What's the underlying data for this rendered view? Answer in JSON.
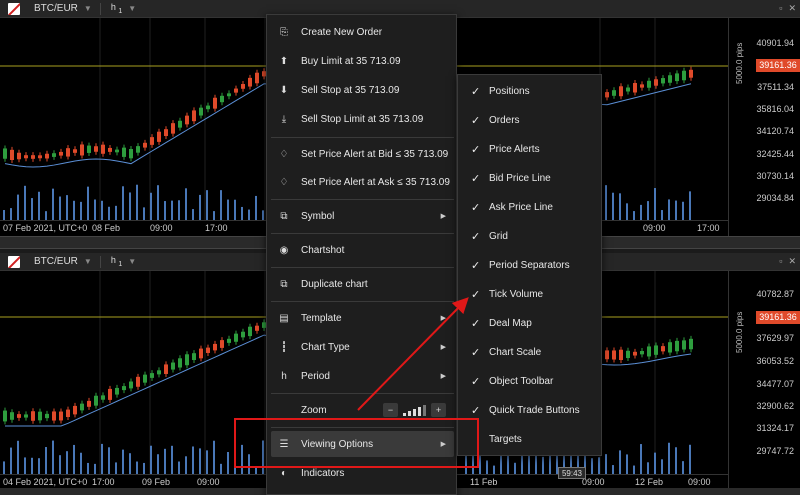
{
  "top_chart": {
    "symbol": "BTC/EUR",
    "period_label": "h",
    "period_sub": "1",
    "y_ticks": [
      "40901.94",
      "37511.34",
      "35816.04",
      "34120.74",
      "32425.44",
      "30730.14",
      "29034.84"
    ],
    "price_label": "39161.36",
    "pips_label": "5000.0 pips",
    "x_ticks": [
      "07 Feb 2021, UTC+0",
      "08 Feb",
      "09:00",
      "17:00",
      "09:00",
      "17:00"
    ]
  },
  "bottom_chart": {
    "symbol": "BTC/EUR",
    "period_label": "h",
    "period_sub": "1",
    "y_ticks": [
      "40782.87",
      "39161.36",
      "37629.97",
      "36053.52",
      "34477.07",
      "32900.62",
      "31324.17",
      "29747.72"
    ],
    "price_label": "39161.36",
    "pips_label": "5000.0 pips",
    "x_ticks": [
      "04 Feb 2021, UTC+0",
      "17:00",
      "09 Feb",
      "09:00",
      "11 Feb",
      "09:00",
      "12 Feb",
      "09:00"
    ],
    "time_badge": "59:43"
  },
  "context_menu": {
    "items": [
      {
        "label": "Create New Order",
        "icon": "new-order-icon",
        "glyph": "⎘"
      },
      {
        "label": "Buy Limit at 35 713.09",
        "icon": "buy-limit-icon",
        "glyph": "⬆"
      },
      {
        "label": "Sell Stop at 35 713.09",
        "icon": "sell-stop-icon",
        "glyph": "⬇"
      },
      {
        "label": "Sell Stop Limit at 35 713.09",
        "icon": "sell-stop-limit-icon",
        "glyph": "⤓"
      },
      {
        "label": "Set Price Alert at Bid ≤ 35 713.09",
        "icon": "bell-icon",
        "glyph": "🔔"
      },
      {
        "label": "Set Price Alert at Ask ≤ 35 713.09",
        "icon": "bell-icon",
        "glyph": "🔔"
      },
      {
        "label": "Symbol",
        "icon": "symbol-chart-icon",
        "glyph": "⧉"
      },
      {
        "label": "Chartshot",
        "icon": "camera-icon",
        "glyph": "◉"
      },
      {
        "label": "Duplicate chart",
        "icon": "duplicate-chart-icon",
        "glyph": "⧉"
      },
      {
        "label": "Template",
        "icon": "template-icon",
        "glyph": "▤"
      },
      {
        "label": "Chart Type",
        "icon": "candlestick-icon",
        "glyph": "┇"
      },
      {
        "label": "Period",
        "icon": "period-icon",
        "glyph": "h"
      },
      {
        "label": "Zoom",
        "icon": "zoom-icon",
        "glyph": ""
      },
      {
        "label": "Viewing Options",
        "icon": "viewing-options-icon",
        "glyph": "☰"
      },
      {
        "label": "Indicators",
        "icon": "indicators-icon",
        "glyph": "◐"
      }
    ]
  },
  "viewing_options_submenu": {
    "items": [
      "Positions",
      "Orders",
      "Price Alerts",
      "Bid Price Line",
      "Ask Price Line",
      "Grid",
      "Period Separators",
      "Tick Volume",
      "Deal Map",
      "Chart Scale",
      "Object Toolbar",
      "Quick Trade Buttons",
      "Targets"
    ],
    "checked": [
      true,
      true,
      true,
      true,
      true,
      true,
      true,
      true,
      true,
      true,
      true,
      true,
      false
    ]
  },
  "colors": {
    "up_candle": "#2e9e3e",
    "down_candle": "#e04a2a",
    "price_line": "#a8a020",
    "ma_line": "#5b8fd6",
    "volume": "#4a78b8",
    "annotation": "#e01818"
  }
}
